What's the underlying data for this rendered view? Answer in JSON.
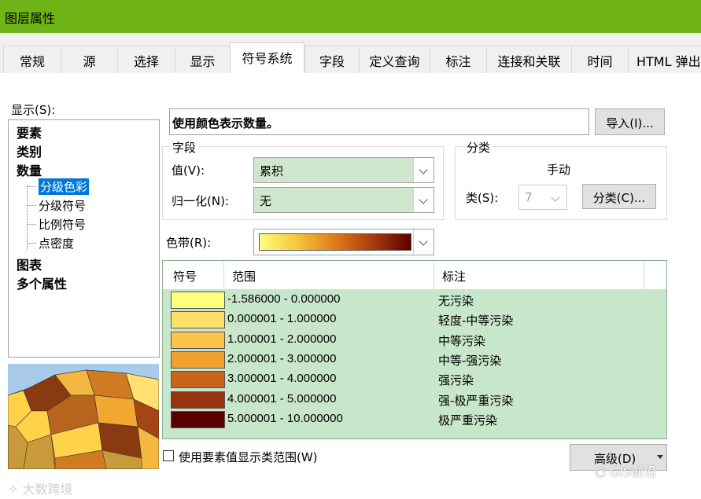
{
  "window": {
    "title": "图层属性"
  },
  "tabs": [
    {
      "label": "常规"
    },
    {
      "label": "源"
    },
    {
      "label": "选择"
    },
    {
      "label": "显示"
    },
    {
      "label": "符号系统"
    },
    {
      "label": "字段"
    },
    {
      "label": "定义查询"
    },
    {
      "label": "标注"
    },
    {
      "label": "连接和关联"
    },
    {
      "label": "时间"
    },
    {
      "label": "HTML 弹出"
    }
  ],
  "show": {
    "label": "显示(S):",
    "items": [
      "要素",
      "类别",
      "数量"
    ],
    "subitems": [
      "分级色彩",
      "分级符号",
      "比例符号",
      "点密度"
    ],
    "items_after": [
      "图表",
      "多个属性"
    ]
  },
  "description": "使用颜色表示数量。",
  "import_button": "导入(I)...",
  "fields": {
    "title": "字段",
    "value_label": "值(V):",
    "value": "累积",
    "normalize_label": "归一化(N):",
    "normalize": "无"
  },
  "classification": {
    "title": "分类",
    "method": "手动",
    "classes_label": "类(S):",
    "classes": "7",
    "classify_button": "分类(C)..."
  },
  "color_ramp_label": "色带(R):",
  "table": {
    "headers": [
      "符号",
      "范围",
      "标注"
    ],
    "rows": [
      {
        "color": "#ffff80",
        "range": "-1.586000 - 0.000000",
        "label": "无污染"
      },
      {
        "color": "#ffe066",
        "range": "0.000001 - 1.000000",
        "label": "轻度-中等污染"
      },
      {
        "color": "#fcc44a",
        "range": "1.000001 - 2.000000",
        "label": "中等污染"
      },
      {
        "color": "#f0a030",
        "range": "2.000001 - 3.000000",
        "label": "中等-强污染"
      },
      {
        "color": "#c8641a",
        "range": "3.000001 - 4.000000",
        "label": "强污染"
      },
      {
        "color": "#983210",
        "range": "4.000001 - 5.000000",
        "label": "强-极严重污染"
      },
      {
        "color": "#5a0000",
        "range": "5.000001 - 10.000000",
        "label": "极严重污染"
      }
    ]
  },
  "show_values_checkbox": "使用要素值显示类范围(W)",
  "advanced_button": "高级(D)",
  "watermark_left": "大数跨境",
  "watermark_right": "GIS前沿"
}
